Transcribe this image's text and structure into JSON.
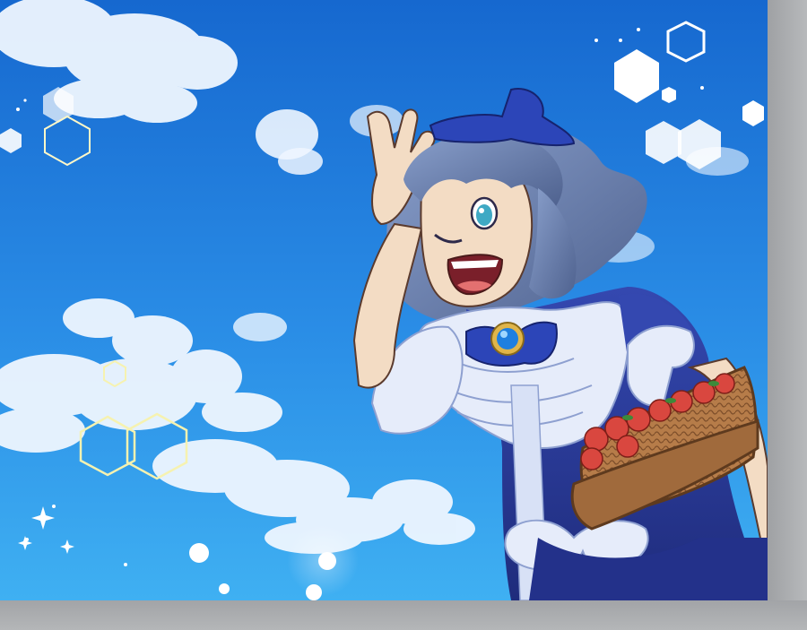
{
  "image": {
    "subject": "anime-girl-with-apple-basket",
    "colors": {
      "sky_top": "#1a73d6",
      "sky_bottom": "#3aa6ee",
      "cloud": "#eef6ff",
      "hair": "#6f86b4",
      "dress": "#2c3e9c",
      "ruffle": "#e6ecfa",
      "skin": "#f3dcc4",
      "basket": "#b07a4a",
      "apple": "#d9473f",
      "brooch": "#1e7fe0",
      "border": "#a9abad"
    }
  }
}
